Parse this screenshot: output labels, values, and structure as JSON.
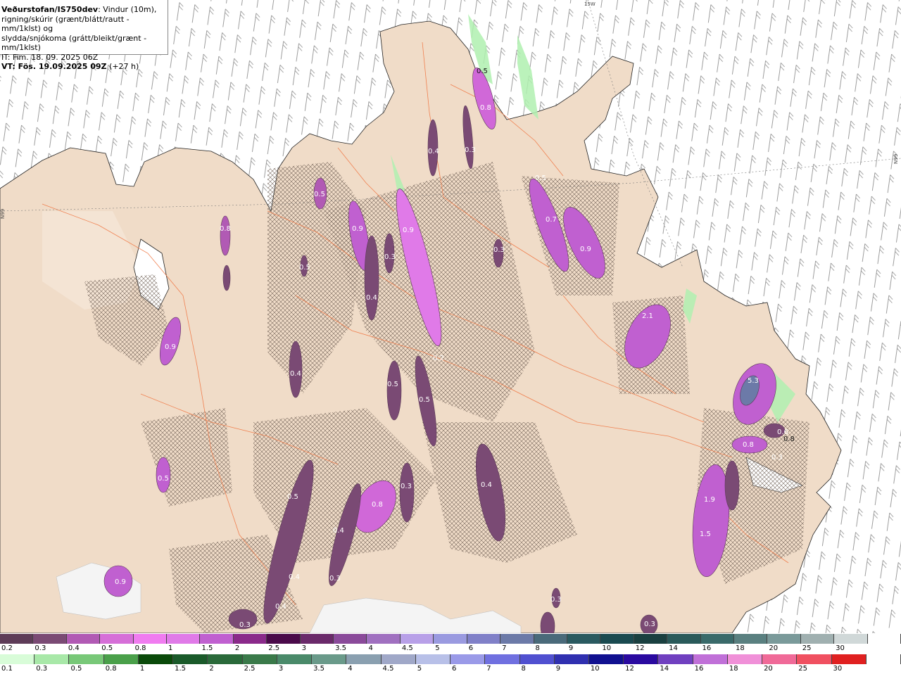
{
  "header": {
    "source": "Veðurstofan/IS750dev",
    "desc_line1": ": Vindur (10m),",
    "desc_line2": "rigning/skúrir (grænt/blátt/rautt - mm/1klst) og",
    "desc_line3": "slydda/snjókoma (grátt/bleikt/grænt - mm/1klst)",
    "it": "IT: Fim. 18. 09. 2025 06Z",
    "vt_label": "VT: Fös. 19.09.2025 09Z",
    "vt_offset": " (+27 h)"
  },
  "grid_labels": {
    "top": "15W",
    "left": "N99",
    "right": "N99"
  },
  "map_values": [
    {
      "id": "v1",
      "text": "0.5"
    },
    {
      "id": "v2",
      "text": "0.8"
    },
    {
      "id": "v3",
      "text": "0.4"
    },
    {
      "id": "v4",
      "text": "0.3"
    },
    {
      "id": "v5",
      "text": "0.5"
    },
    {
      "id": "v6",
      "text": "0.8"
    },
    {
      "id": "v7",
      "text": "0.9"
    },
    {
      "id": "v8",
      "text": "0.3"
    },
    {
      "id": "v9",
      "text": "0.9"
    },
    {
      "id": "v10",
      "text": "0.4"
    },
    {
      "id": "v11",
      "text": "0.5"
    },
    {
      "id": "v12",
      "text": "0.7"
    },
    {
      "id": "v13",
      "text": "0.9"
    },
    {
      "id": "v14",
      "text": "0.3"
    },
    {
      "id": "v15",
      "text": "2.1"
    },
    {
      "id": "v16",
      "text": "0.9"
    },
    {
      "id": "v17",
      "text": "0.4"
    },
    {
      "id": "v18",
      "text": "0.5"
    },
    {
      "id": "v19",
      "text": "0.5"
    },
    {
      "id": "v20",
      "text": "0.5"
    },
    {
      "id": "v21",
      "text": "0.5"
    },
    {
      "id": "v22",
      "text": "0.8"
    },
    {
      "id": "v23",
      "text": "0.3"
    },
    {
      "id": "v24",
      "text": "0.4"
    },
    {
      "id": "v25",
      "text": "0.4"
    },
    {
      "id": "v26",
      "text": "0.4"
    },
    {
      "id": "v27",
      "text": "0.3"
    },
    {
      "id": "v28",
      "text": "0.4"
    },
    {
      "id": "v29",
      "text": "0.3"
    },
    {
      "id": "v30",
      "text": "0.9"
    },
    {
      "id": "v31",
      "text": "5.3"
    },
    {
      "id": "v32",
      "text": "0.6"
    },
    {
      "id": "v33",
      "text": "0.8"
    },
    {
      "id": "v34",
      "text": "0.8"
    },
    {
      "id": "v35",
      "text": "0.3"
    },
    {
      "id": "v36",
      "text": "1.9"
    },
    {
      "id": "v37",
      "text": "1.5"
    },
    {
      "id": "v38",
      "text": "0.3"
    },
    {
      "id": "v39",
      "text": "0.3"
    },
    {
      "id": "v40",
      "text": "0.5"
    },
    {
      "id": "v41",
      "text": "0.2"
    }
  ],
  "snow_scale": {
    "labels": [
      "0.2",
      "0.3",
      "0.4",
      "0.5",
      "0.8",
      "1",
      "1.5",
      "2",
      "2.5",
      "3",
      "3.5",
      "4",
      "4.5",
      "5",
      "6",
      "7",
      "8",
      "9",
      "10",
      "12",
      "14",
      "16",
      "18",
      "20",
      "25",
      "30"
    ],
    "colors": [
      "#5e3c58",
      "#7a4a74",
      "#b15ab4",
      "#d66fd8",
      "#f07cf0",
      "#e07ae8",
      "#c060d0",
      "#8a2a8a",
      "#4a0a4a",
      "#6a2a6a",
      "#8a4a9a",
      "#a070c0",
      "#b8a0e8",
      "#9a9ae0",
      "#8080c8",
      "#6c7aa8",
      "#4a6a7a",
      "#2a5a60",
      "#1a4a50",
      "#1a4040",
      "#2a5a5a",
      "#3a6a6a",
      "#5a8080",
      "#7a9a9a",
      "#a0b0b0",
      "#d0d8d8",
      "#ffffff"
    ]
  },
  "rain_scale": {
    "labels": [
      "0.1",
      "0.3",
      "0.5",
      "0.8",
      "1",
      "1.5",
      "2",
      "2.5",
      "3",
      "3.5",
      "4",
      "4.5",
      "5",
      "6",
      "7",
      "8",
      "9",
      "10",
      "12",
      "14",
      "16",
      "18",
      "20",
      "25",
      "30"
    ],
    "colors": [
      "#d8fcd8",
      "#a8e8a8",
      "#78c878",
      "#4aa04a",
      "#0a4a0a",
      "#1a5a2a",
      "#2a6a3a",
      "#3a7a4a",
      "#4a8a6a",
      "#6a9a8a",
      "#8aa0b0",
      "#a0a8c8",
      "#b8c0e8",
      "#9a9ae8",
      "#7070e0",
      "#5050d0",
      "#3030b0",
      "#101090",
      "#2a0aa0",
      "#7040c0",
      "#c070d8",
      "#f090d8",
      "#f06a98",
      "#f05060",
      "#e02020",
      "#ffffff"
    ]
  }
}
